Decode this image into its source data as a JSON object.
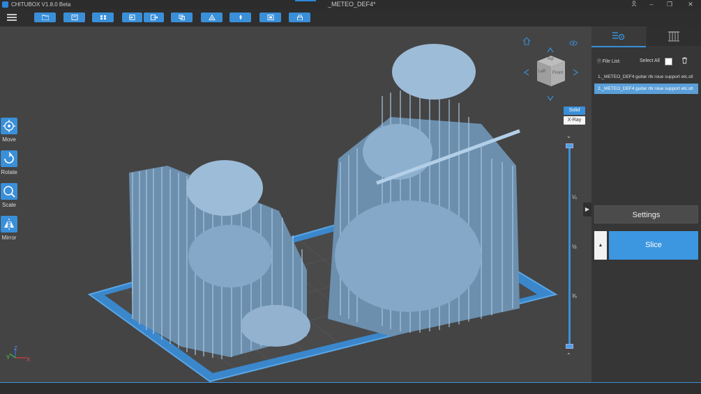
{
  "window": {
    "app_title": "CHITUBOX V1.8.0 Beta",
    "doc_title": "_METEO_DEF4*"
  },
  "toolbar": {
    "buttons": [
      "open-folder-icon",
      "save-icon",
      "arrange-icon",
      "import-icon",
      "export-icon",
      "copy-icon",
      "hollow-icon",
      "support-icon",
      "dig-hole-icon",
      "frame-icon",
      "lock-icon"
    ]
  },
  "left_tools": [
    {
      "label": "Move",
      "icon": "move-icon"
    },
    {
      "label": "Rotate",
      "icon": "rotate-icon"
    },
    {
      "label": "Scale",
      "icon": "scale-icon"
    },
    {
      "label": "Mirror",
      "icon": "mirror-icon"
    }
  ],
  "view_cube": {
    "top": "Top",
    "left": "Left",
    "front": "Front"
  },
  "render_modes": {
    "solid": "Solid",
    "xray": "X-Ray",
    "active": "Solid"
  },
  "layer_slider": {
    "marks": [
      "¼",
      "½",
      "¾"
    ],
    "position_fraction": 1.0
  },
  "axes": {
    "z": "Z",
    "y": "Y",
    "x": "X"
  },
  "sidebar": {
    "file_list_label": "File List:",
    "select_all_label": "Select All",
    "files": [
      {
        "name": "1._METEO_DEF4 guitar rtk roue support etc.stl",
        "selected": false
      },
      {
        "name": "2._METEO_DEF4 guitar rtk roue support etc.stl",
        "selected": true
      }
    ],
    "settings_label": "Settings",
    "slice_label": "Slice"
  },
  "colors": {
    "accent": "#3a8fd9",
    "model": "#8fb3d3",
    "plate": "#4a92d6"
  }
}
